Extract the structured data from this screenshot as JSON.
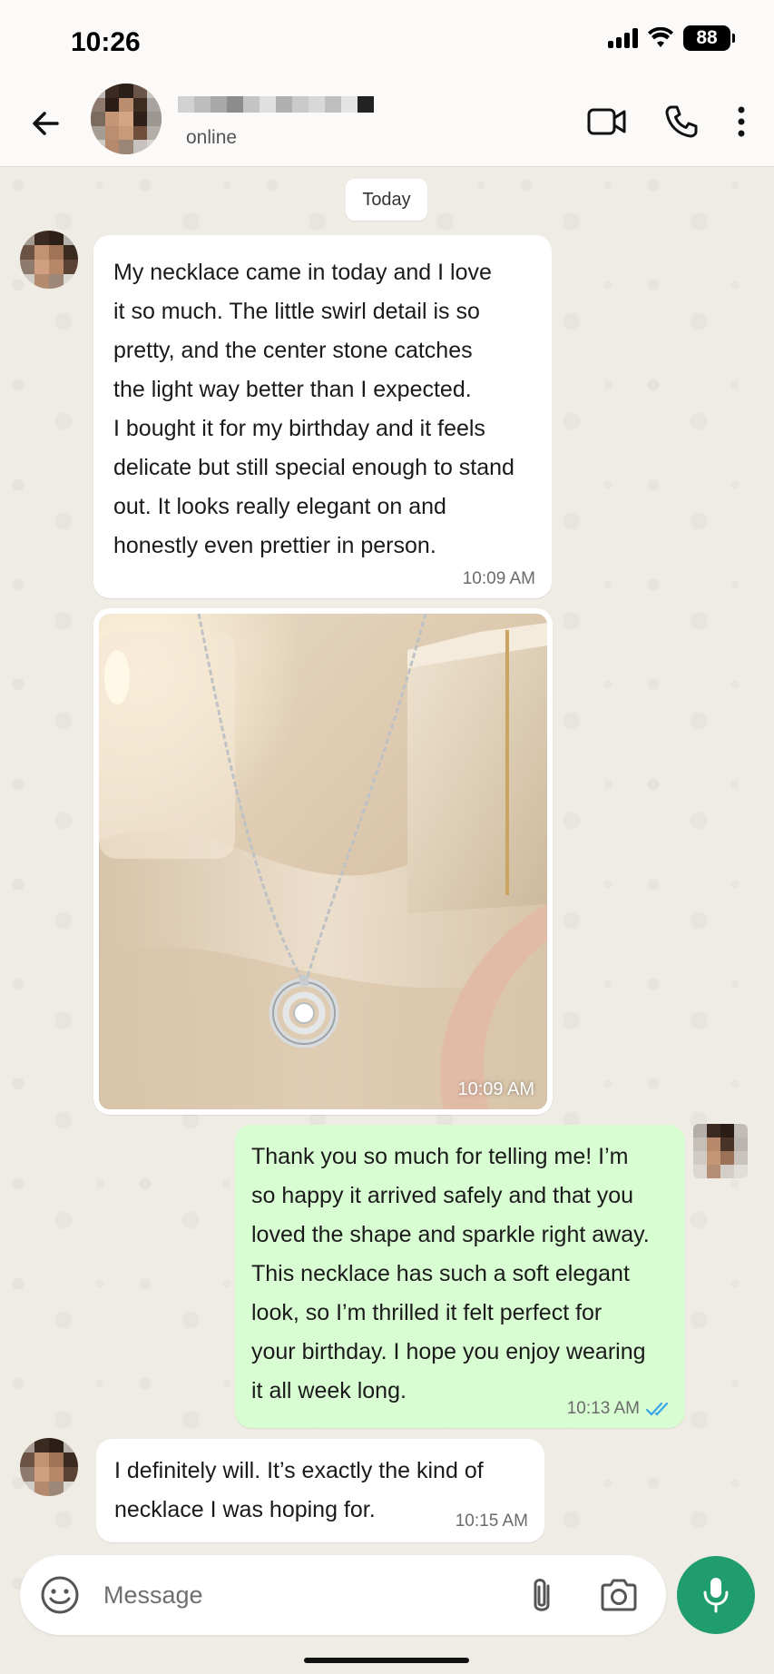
{
  "status_bar": {
    "time": "10:26",
    "battery": "88"
  },
  "header": {
    "contact_status": "online"
  },
  "date_chip": "Today",
  "messages": [
    {
      "direction": "in",
      "text": "My necklace came in today and I love\nit so much. The little swirl detail is so\npretty, and the center stone catches\nthe light way better than I expected.\nI bought it for my birthday and it feels\ndelicate but still special enough to stand\nout. It looks really elegant on and\nhonestly even prettier in person.",
      "time": "10:09 AM"
    },
    {
      "direction": "in",
      "type": "photo",
      "time": "10:09 AM"
    },
    {
      "direction": "out",
      "text": "Thank you so much for telling me! I’m\nso happy it arrived safely and that you\nloved the shape and sparkle right away.\nThis necklace has such a soft elegant\nlook, so I’m thrilled it felt perfect for\nyour birthday. I hope you enjoy wearing\nit all week long.",
      "time": "10:13 AM",
      "read": true
    },
    {
      "direction": "in",
      "text": "I definitely will. It’s exactly the kind of\nnecklace I was hoping for.",
      "time": "10:15 AM"
    }
  ],
  "composer": {
    "placeholder": "Message"
  },
  "colors": {
    "accent": "#1f9d6e",
    "outgoing_bubble": "#d9fdd3",
    "read_ticks": "#3ba5e8"
  },
  "icons": [
    "back-arrow-icon",
    "video-call-icon",
    "phone-icon",
    "more-vertical-icon",
    "emoji-icon",
    "attach-icon",
    "camera-icon",
    "mic-icon"
  ]
}
